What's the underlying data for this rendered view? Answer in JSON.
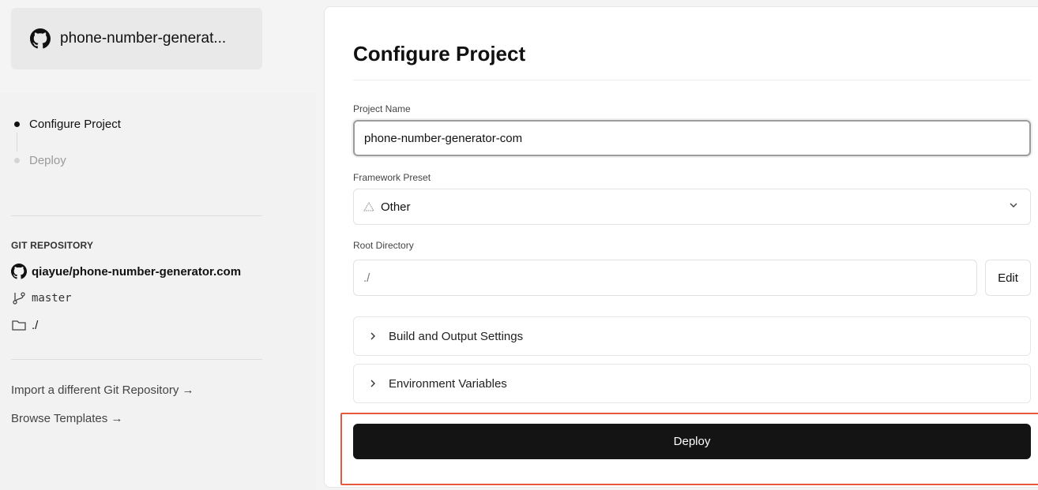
{
  "repo_card": {
    "name": "phone-number-generat...",
    "icon": "github-icon"
  },
  "steps": [
    {
      "label": "Configure Project",
      "active": true
    },
    {
      "label": "Deploy",
      "active": false
    }
  ],
  "git": {
    "title": "GIT REPOSITORY",
    "repo": "qiayue/phone-number-generator.com",
    "branch": "master",
    "directory": "./"
  },
  "links": {
    "import": "Import a different Git Repository →",
    "templates": "Browse Templates →"
  },
  "form": {
    "title": "Configure Project",
    "project_name_label": "Project Name",
    "project_name_value": "phone-number-generator-com",
    "framework_label": "Framework Preset",
    "framework_value": "Other",
    "root_dir_label": "Root Directory",
    "root_dir_value": "./",
    "edit_label": "Edit",
    "build_settings": "Build and Output Settings",
    "env_vars": "Environment Variables",
    "deploy_label": "Deploy"
  },
  "colors": {
    "accent": "#141414",
    "highlight": "#e8583c"
  }
}
